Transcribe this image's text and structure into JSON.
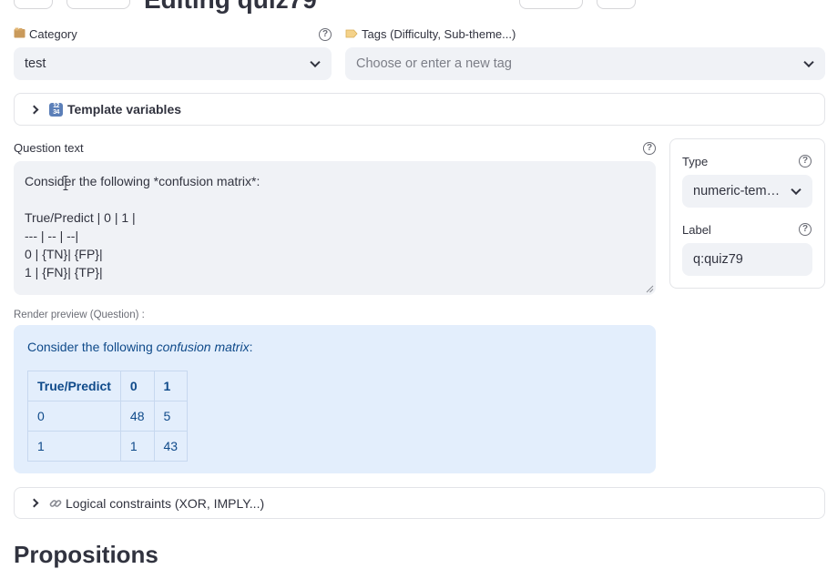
{
  "header": {
    "title": "Editing quiz79"
  },
  "category": {
    "label": "Category",
    "icon": "card-index-dividers-icon",
    "value": "test"
  },
  "tags": {
    "label": "Tags (Difficulty, Sub-theme...)",
    "icon": "label-tag-icon",
    "placeholder": "Choose or enter a new tag"
  },
  "template_variables": {
    "label": "Template variables",
    "icon": "input-numbers-icon"
  },
  "question": {
    "label": "Question text",
    "text": "Consider the following *confusion matrix*:\n\nTrue/Predict | 0 | 1 |\n--- | -- | --|\n0 | {TN}| {FP}|\n1 | {FN}| {TP}|"
  },
  "preview": {
    "label": "Render preview (Question) :",
    "intro_plain": "Consider the following ",
    "intro_em": "confusion matrix",
    "intro_end": ":",
    "table": {
      "headers": [
        "True/Predict",
        "0",
        "1"
      ],
      "rows": [
        [
          "0",
          "48",
          "5"
        ],
        [
          "1",
          "1",
          "43"
        ]
      ]
    }
  },
  "side": {
    "type_label": "Type",
    "type_value": "numeric-tem…",
    "label_label": "Label",
    "label_value": "q:quiz79"
  },
  "constraints": {
    "label": "Logical constraints (XOR, IMPLY...)",
    "icon": "link-icon"
  },
  "propositions": {
    "title": "Propositions"
  },
  "colors": {
    "accent_text": "#0f4a8a",
    "preview_bg": "#e3eefc",
    "input_bg": "#f0f2f6"
  }
}
